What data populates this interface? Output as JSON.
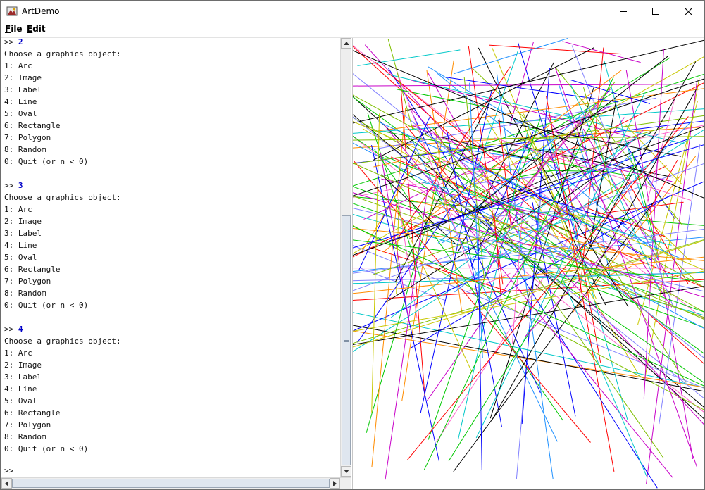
{
  "window": {
    "title": "ArtDemo",
    "icon": "app-icon",
    "controls": [
      "minimize-icon",
      "maximize-icon",
      "close-icon"
    ]
  },
  "menu": {
    "file": {
      "mnemonic": "F",
      "rest": "ile"
    },
    "edit": {
      "mnemonic": "E",
      "rest": "dit"
    }
  },
  "console": {
    "heading": "Choose a graphics object:",
    "options": [
      "1: Arc",
      "2: Image",
      "3: Label",
      "4: Line",
      "5: Oval",
      "6: Rectangle",
      "7: Polygon",
      "8: Random",
      "0: Quit (or n < 0)"
    ],
    "prompt": ">>",
    "entries": [
      "2",
      "3",
      "4"
    ],
    "current_input": ""
  },
  "canvas": {
    "background": "#ffffff",
    "palette": [
      "#ff0000",
      "#00c800",
      "#0000ff",
      "#c800c8",
      "#00c8c8",
      "#c8c800",
      "#000000",
      "#ff8c00",
      "#7fbf00",
      "#8080ff",
      "#ff66cc",
      "#1e90ff"
    ]
  },
  "scrollbars": {
    "vertical": {
      "position_fraction": 1.0
    },
    "horizontal": {
      "position_fraction": 0.0
    }
  }
}
